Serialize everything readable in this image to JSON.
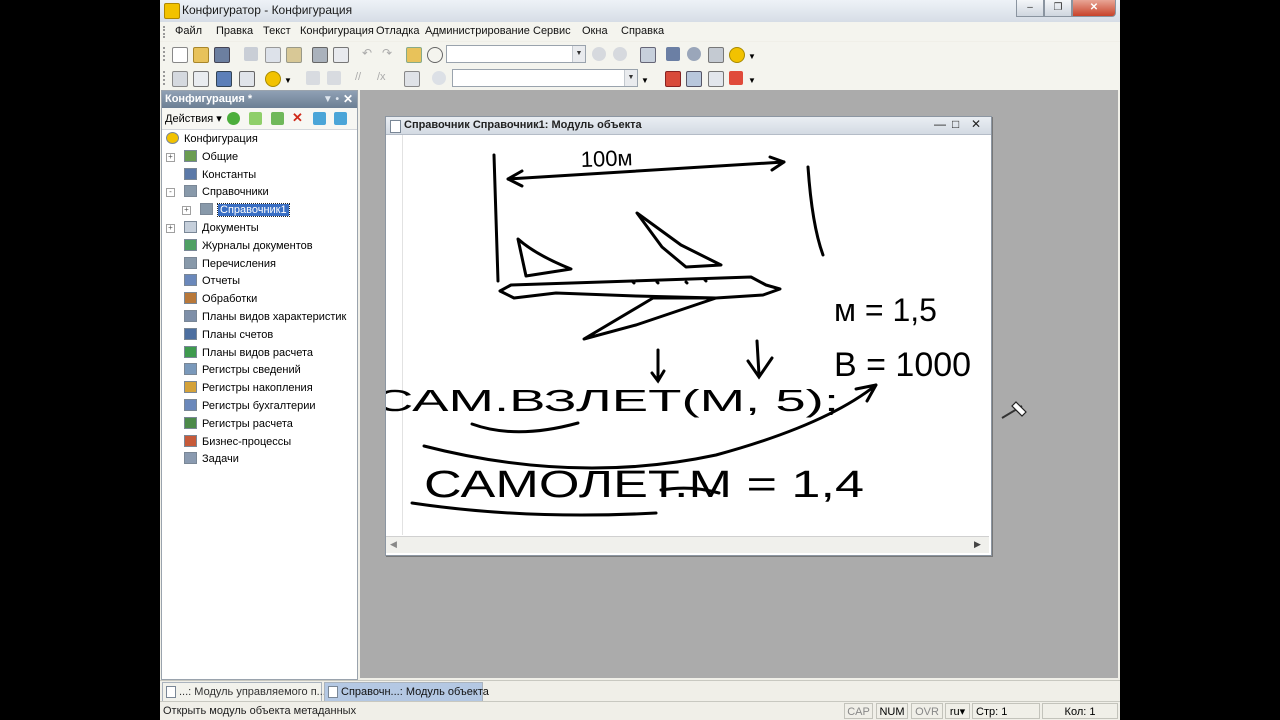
{
  "window": {
    "title": "Конфигуратор - Конфигурация"
  },
  "menu": [
    "Файл",
    "Правка",
    "Текст",
    "Конфигурация",
    "Отладка",
    "Администрирование",
    "Сервис",
    "Окна",
    "Справка"
  ],
  "toolbar": {
    "search_value": "",
    "combo2_value": ""
  },
  "panel": {
    "title": "Конфигурация *",
    "actions_label": "Действия",
    "tree": [
      {
        "label": "Конфигурация",
        "level": 0,
        "icon": "config-icon",
        "expander": ""
      },
      {
        "label": "Общие",
        "level": 1,
        "icon": "common-icon",
        "expander": "+"
      },
      {
        "label": "Константы",
        "level": 1,
        "icon": "constants-icon",
        "expander": ""
      },
      {
        "label": "Справочники",
        "level": 1,
        "icon": "catalogs-icon",
        "expander": "-"
      },
      {
        "label": "Справочник1",
        "level": 2,
        "icon": "catalog-icon",
        "expander": "+",
        "selected": true
      },
      {
        "label": "Документы",
        "level": 1,
        "icon": "documents-icon",
        "expander": "+"
      },
      {
        "label": "Журналы документов",
        "level": 1,
        "icon": "journals-icon",
        "expander": ""
      },
      {
        "label": "Перечисления",
        "level": 1,
        "icon": "enums-icon",
        "expander": ""
      },
      {
        "label": "Отчеты",
        "level": 1,
        "icon": "reports-icon",
        "expander": ""
      },
      {
        "label": "Обработки",
        "level": 1,
        "icon": "dataprocessors-icon",
        "expander": ""
      },
      {
        "label": "Планы видов характеристик",
        "level": 1,
        "icon": "chart-of-characteristics-icon",
        "expander": ""
      },
      {
        "label": "Планы счетов",
        "level": 1,
        "icon": "chart-of-accounts-icon",
        "expander": ""
      },
      {
        "label": "Планы видов расчета",
        "level": 1,
        "icon": "calculation-types-icon",
        "expander": ""
      },
      {
        "label": "Регистры сведений",
        "level": 1,
        "icon": "info-registers-icon",
        "expander": ""
      },
      {
        "label": "Регистры накопления",
        "level": 1,
        "icon": "accumulation-registers-icon",
        "expander": ""
      },
      {
        "label": "Регистры бухгалтерии",
        "level": 1,
        "icon": "accounting-registers-icon",
        "expander": ""
      },
      {
        "label": "Регистры расчета",
        "level": 1,
        "icon": "calculation-registers-icon",
        "expander": ""
      },
      {
        "label": "Бизнес-процессы",
        "level": 1,
        "icon": "business-processes-icon",
        "expander": ""
      },
      {
        "label": "Задачи",
        "level": 1,
        "icon": "tasks-icon",
        "expander": ""
      }
    ]
  },
  "child_window": {
    "title": "Справочник Справочник1: Модуль объекта",
    "drawing_text": {
      "dimension": "100м",
      "m_eq": "м = 1,5",
      "v_eq": "В = 1000",
      "code1": "САМ.ВЗЛЕТ(М, 5);",
      "code2": "САМОЛЕТ.М = 1,4"
    }
  },
  "tabs": [
    {
      "label": "...: Модуль управляемого п...",
      "active": false
    },
    {
      "label": "Справочн...: Модуль объекта",
      "active": true
    }
  ],
  "status": {
    "message": "Открыть модуль объекта метаданных",
    "cap": "CAP",
    "num": "NUM",
    "ovr": "OVR",
    "lang": "ru",
    "line": "Стр: 1",
    "col": "Кол: 1"
  }
}
